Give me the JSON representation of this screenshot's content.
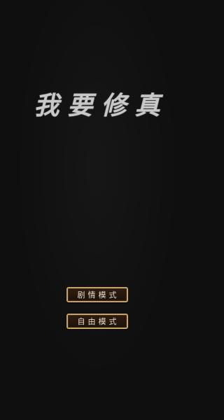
{
  "title": "我要修真",
  "buttons": {
    "story_mode": "剧情模式",
    "free_mode": "自由模式"
  },
  "colors": {
    "background": "#0f0f0f",
    "button_border": "#c8a26e",
    "button_fill": "#2a1a0f",
    "title_text": "#c8c8c8",
    "button_text": "#e8dcc8"
  }
}
